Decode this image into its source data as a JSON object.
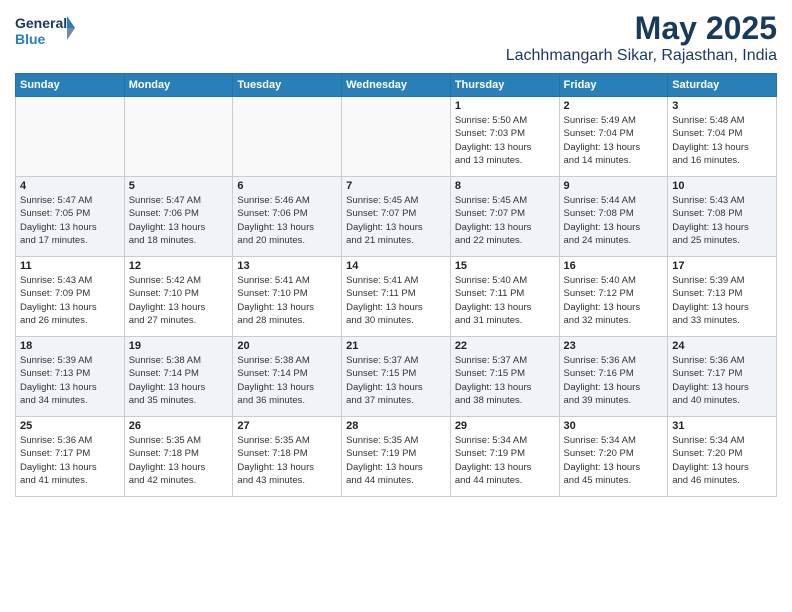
{
  "header": {
    "logo_line1": "General",
    "logo_line2": "Blue",
    "month": "May 2025",
    "location": "Lachhmangarh Sikar, Rajasthan, India"
  },
  "weekdays": [
    "Sunday",
    "Monday",
    "Tuesday",
    "Wednesday",
    "Thursday",
    "Friday",
    "Saturday"
  ],
  "weeks": [
    [
      {
        "day": "",
        "info": ""
      },
      {
        "day": "",
        "info": ""
      },
      {
        "day": "",
        "info": ""
      },
      {
        "day": "",
        "info": ""
      },
      {
        "day": "1",
        "info": "Sunrise: 5:50 AM\nSunset: 7:03 PM\nDaylight: 13 hours\nand 13 minutes."
      },
      {
        "day": "2",
        "info": "Sunrise: 5:49 AM\nSunset: 7:04 PM\nDaylight: 13 hours\nand 14 minutes."
      },
      {
        "day": "3",
        "info": "Sunrise: 5:48 AM\nSunset: 7:04 PM\nDaylight: 13 hours\nand 16 minutes."
      }
    ],
    [
      {
        "day": "4",
        "info": "Sunrise: 5:47 AM\nSunset: 7:05 PM\nDaylight: 13 hours\nand 17 minutes."
      },
      {
        "day": "5",
        "info": "Sunrise: 5:47 AM\nSunset: 7:06 PM\nDaylight: 13 hours\nand 18 minutes."
      },
      {
        "day": "6",
        "info": "Sunrise: 5:46 AM\nSunset: 7:06 PM\nDaylight: 13 hours\nand 20 minutes."
      },
      {
        "day": "7",
        "info": "Sunrise: 5:45 AM\nSunset: 7:07 PM\nDaylight: 13 hours\nand 21 minutes."
      },
      {
        "day": "8",
        "info": "Sunrise: 5:45 AM\nSunset: 7:07 PM\nDaylight: 13 hours\nand 22 minutes."
      },
      {
        "day": "9",
        "info": "Sunrise: 5:44 AM\nSunset: 7:08 PM\nDaylight: 13 hours\nand 24 minutes."
      },
      {
        "day": "10",
        "info": "Sunrise: 5:43 AM\nSunset: 7:08 PM\nDaylight: 13 hours\nand 25 minutes."
      }
    ],
    [
      {
        "day": "11",
        "info": "Sunrise: 5:43 AM\nSunset: 7:09 PM\nDaylight: 13 hours\nand 26 minutes."
      },
      {
        "day": "12",
        "info": "Sunrise: 5:42 AM\nSunset: 7:10 PM\nDaylight: 13 hours\nand 27 minutes."
      },
      {
        "day": "13",
        "info": "Sunrise: 5:41 AM\nSunset: 7:10 PM\nDaylight: 13 hours\nand 28 minutes."
      },
      {
        "day": "14",
        "info": "Sunrise: 5:41 AM\nSunset: 7:11 PM\nDaylight: 13 hours\nand 30 minutes."
      },
      {
        "day": "15",
        "info": "Sunrise: 5:40 AM\nSunset: 7:11 PM\nDaylight: 13 hours\nand 31 minutes."
      },
      {
        "day": "16",
        "info": "Sunrise: 5:40 AM\nSunset: 7:12 PM\nDaylight: 13 hours\nand 32 minutes."
      },
      {
        "day": "17",
        "info": "Sunrise: 5:39 AM\nSunset: 7:13 PM\nDaylight: 13 hours\nand 33 minutes."
      }
    ],
    [
      {
        "day": "18",
        "info": "Sunrise: 5:39 AM\nSunset: 7:13 PM\nDaylight: 13 hours\nand 34 minutes."
      },
      {
        "day": "19",
        "info": "Sunrise: 5:38 AM\nSunset: 7:14 PM\nDaylight: 13 hours\nand 35 minutes."
      },
      {
        "day": "20",
        "info": "Sunrise: 5:38 AM\nSunset: 7:14 PM\nDaylight: 13 hours\nand 36 minutes."
      },
      {
        "day": "21",
        "info": "Sunrise: 5:37 AM\nSunset: 7:15 PM\nDaylight: 13 hours\nand 37 minutes."
      },
      {
        "day": "22",
        "info": "Sunrise: 5:37 AM\nSunset: 7:15 PM\nDaylight: 13 hours\nand 38 minutes."
      },
      {
        "day": "23",
        "info": "Sunrise: 5:36 AM\nSunset: 7:16 PM\nDaylight: 13 hours\nand 39 minutes."
      },
      {
        "day": "24",
        "info": "Sunrise: 5:36 AM\nSunset: 7:17 PM\nDaylight: 13 hours\nand 40 minutes."
      }
    ],
    [
      {
        "day": "25",
        "info": "Sunrise: 5:36 AM\nSunset: 7:17 PM\nDaylight: 13 hours\nand 41 minutes."
      },
      {
        "day": "26",
        "info": "Sunrise: 5:35 AM\nSunset: 7:18 PM\nDaylight: 13 hours\nand 42 minutes."
      },
      {
        "day": "27",
        "info": "Sunrise: 5:35 AM\nSunset: 7:18 PM\nDaylight: 13 hours\nand 43 minutes."
      },
      {
        "day": "28",
        "info": "Sunrise: 5:35 AM\nSunset: 7:19 PM\nDaylight: 13 hours\nand 44 minutes."
      },
      {
        "day": "29",
        "info": "Sunrise: 5:34 AM\nSunset: 7:19 PM\nDaylight: 13 hours\nand 44 minutes."
      },
      {
        "day": "30",
        "info": "Sunrise: 5:34 AM\nSunset: 7:20 PM\nDaylight: 13 hours\nand 45 minutes."
      },
      {
        "day": "31",
        "info": "Sunrise: 5:34 AM\nSunset: 7:20 PM\nDaylight: 13 hours\nand 46 minutes."
      }
    ]
  ]
}
